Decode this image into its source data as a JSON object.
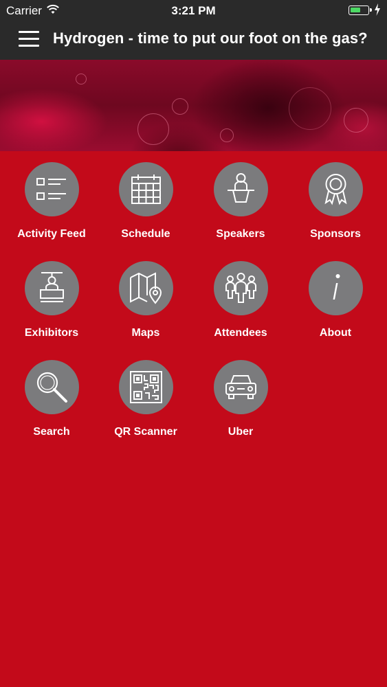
{
  "status_bar": {
    "carrier": "Carrier",
    "time": "3:21 PM",
    "battery_color": "#4cd964"
  },
  "nav": {
    "title": "Hydrogen - time to put our foot on the gas?"
  },
  "theme": {
    "background": "#c30a1a",
    "bar": "#2a2a2a",
    "icon_circle": "#7b7b7d"
  },
  "menu": [
    {
      "label": "Activity Feed",
      "icon": "activity-feed-icon"
    },
    {
      "label": "Schedule",
      "icon": "calendar-icon"
    },
    {
      "label": "Speakers",
      "icon": "speaker-podium-icon"
    },
    {
      "label": "Sponsors",
      "icon": "award-ribbon-icon"
    },
    {
      "label": "Exhibitors",
      "icon": "exhibitor-booth-icon"
    },
    {
      "label": "Maps",
      "icon": "map-pin-icon"
    },
    {
      "label": "Attendees",
      "icon": "people-group-icon"
    },
    {
      "label": "About",
      "icon": "info-icon"
    },
    {
      "label": "Search",
      "icon": "magnifier-icon"
    },
    {
      "label": "QR Scanner",
      "icon": "qr-code-icon"
    },
    {
      "label": "Uber",
      "icon": "car-icon"
    }
  ]
}
